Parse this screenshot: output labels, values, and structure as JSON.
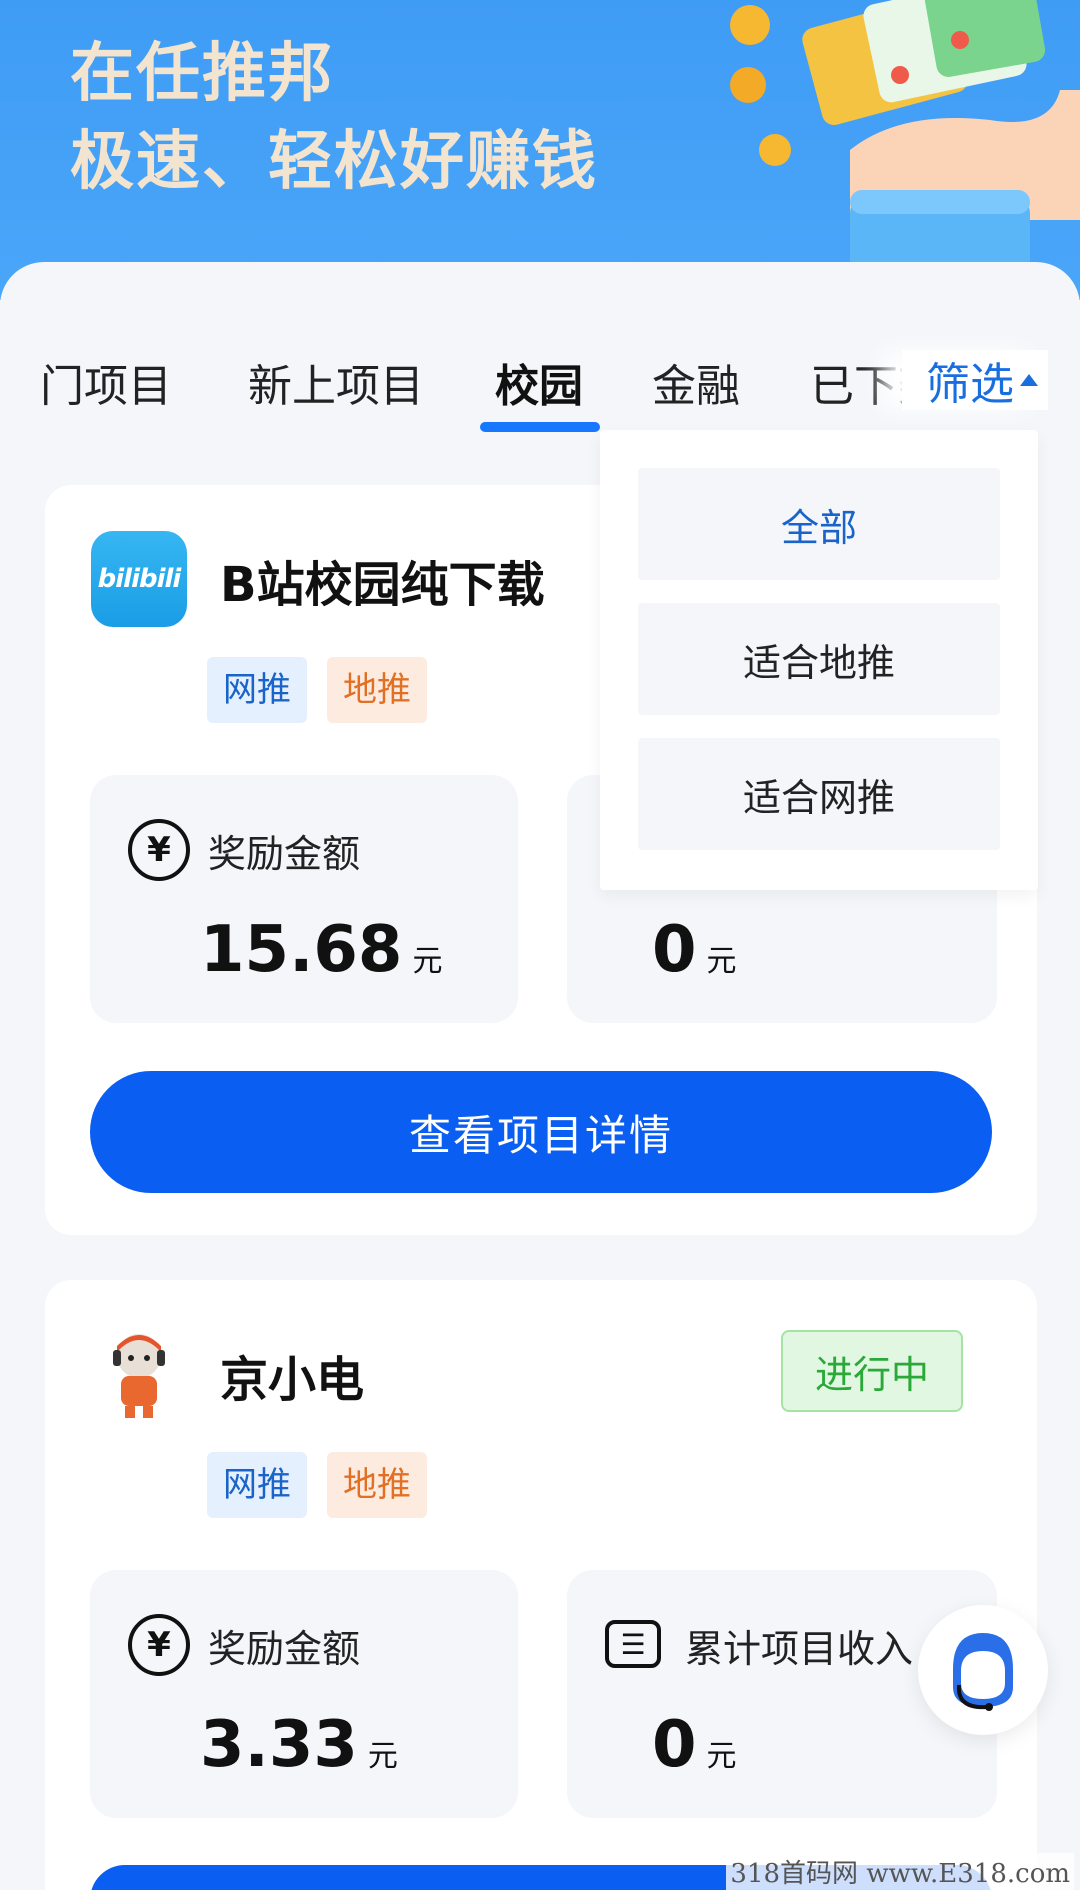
{
  "header": {
    "title_line1": "在任推邦",
    "title_line2": "极速、轻松好赚钱"
  },
  "tabs": [
    {
      "label": "门项目"
    },
    {
      "label": "新上项目"
    },
    {
      "label": "校园",
      "active": true
    },
    {
      "label": "金融"
    },
    {
      "label": "已下架"
    }
  ],
  "filter": {
    "label": "筛选"
  },
  "dropdown": {
    "options": [
      "全部",
      "适合地推",
      "适合网推"
    ],
    "selected": "全部"
  },
  "projects": [
    {
      "icon": "bilibili-app-icon",
      "icon_text": "bilibili",
      "title": "B站校园纯下载",
      "tags": [
        "网推",
        "地推"
      ],
      "reward_label": "奖励金额",
      "reward_value": "15.68",
      "income_value": "0",
      "unit": "元",
      "button": "查看项目详情"
    },
    {
      "icon": "jd-mascot-icon",
      "title": "京小电",
      "status": "进行中",
      "tags": [
        "网推",
        "地推"
      ],
      "reward_label": "奖励金额",
      "reward_value": "3.33",
      "income_label": "累计项目收入",
      "income_value": "0",
      "unit": "元"
    }
  ],
  "watermark": "318首码网 www.E318.com",
  "colors": {
    "header_blue": "#3f9cf5",
    "primary_button": "#0b5ef2",
    "tab_underline": "#1777ff",
    "status_green": "#2aa838"
  }
}
